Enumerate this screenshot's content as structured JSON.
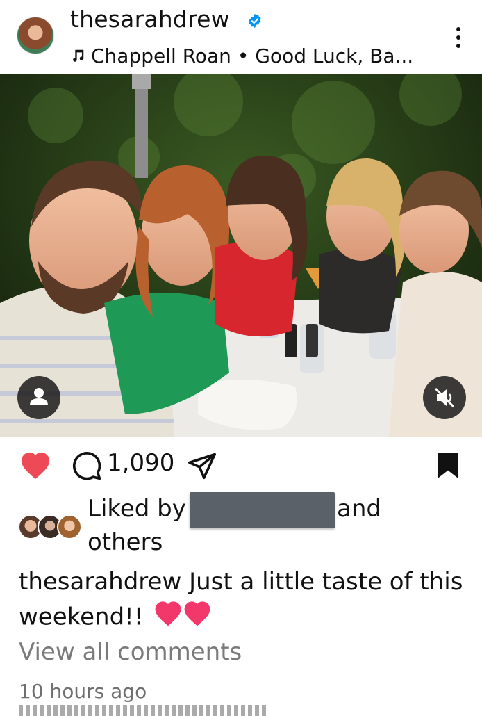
{
  "post": {
    "username": "thesarahdrew",
    "verified": true,
    "music": "Chappell Roan • Good Luck, Ba...",
    "more_icon": "more-vertical-icon"
  },
  "photo": {
    "user_tag_icon": "person-icon",
    "mute_icon": "speaker-muted-icon"
  },
  "actions": {
    "liked": true,
    "like_color": "#ed4956",
    "comment_count": "1,090",
    "saved": true
  },
  "likes": {
    "prefix": "Liked by",
    "suffix": "and",
    "others": "others"
  },
  "caption": {
    "username": "thesarahdrew",
    "text": "Just a little taste of this weekend!!"
  },
  "comments": {
    "view_all": "View all comments"
  },
  "timestamp": "10 hours ago"
}
